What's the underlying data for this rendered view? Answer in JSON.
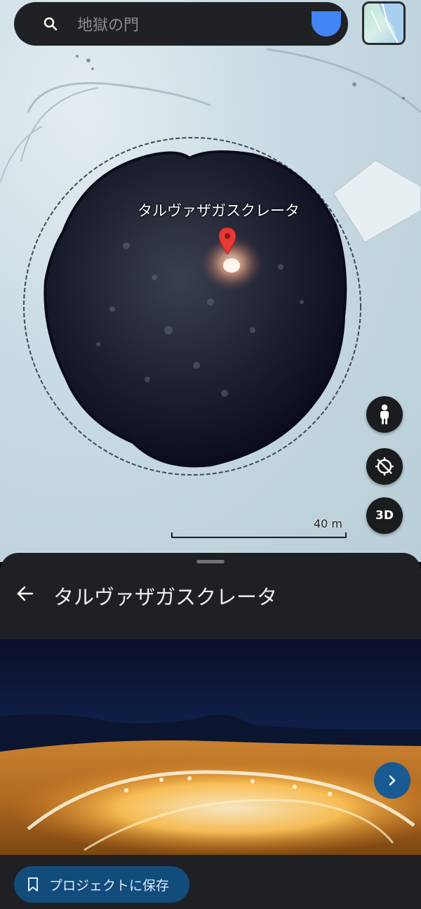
{
  "search": {
    "query": "地獄の門"
  },
  "map": {
    "place_label": "タルヴァザガスクレータ",
    "scale_label": "40 m",
    "fab_3d_label": "3D"
  },
  "sheet": {
    "title": "タルヴァザガスクレータ",
    "save_label": "プロジェクトに保存"
  },
  "icons": {
    "search": "search-icon",
    "mic": "mic-icon",
    "layers": "map-layer-thumbnail",
    "pin": "location-pin-icon",
    "pegman": "pegman-icon",
    "compass": "compass-off-icon",
    "back": "arrow-back-icon",
    "next": "chevron-right-icon",
    "bookmark": "bookmark-icon"
  },
  "colors": {
    "accent": "#4285f4",
    "pin": "#e53935",
    "save_button": "#124c7b",
    "sheet_bg": "#1f2023"
  }
}
